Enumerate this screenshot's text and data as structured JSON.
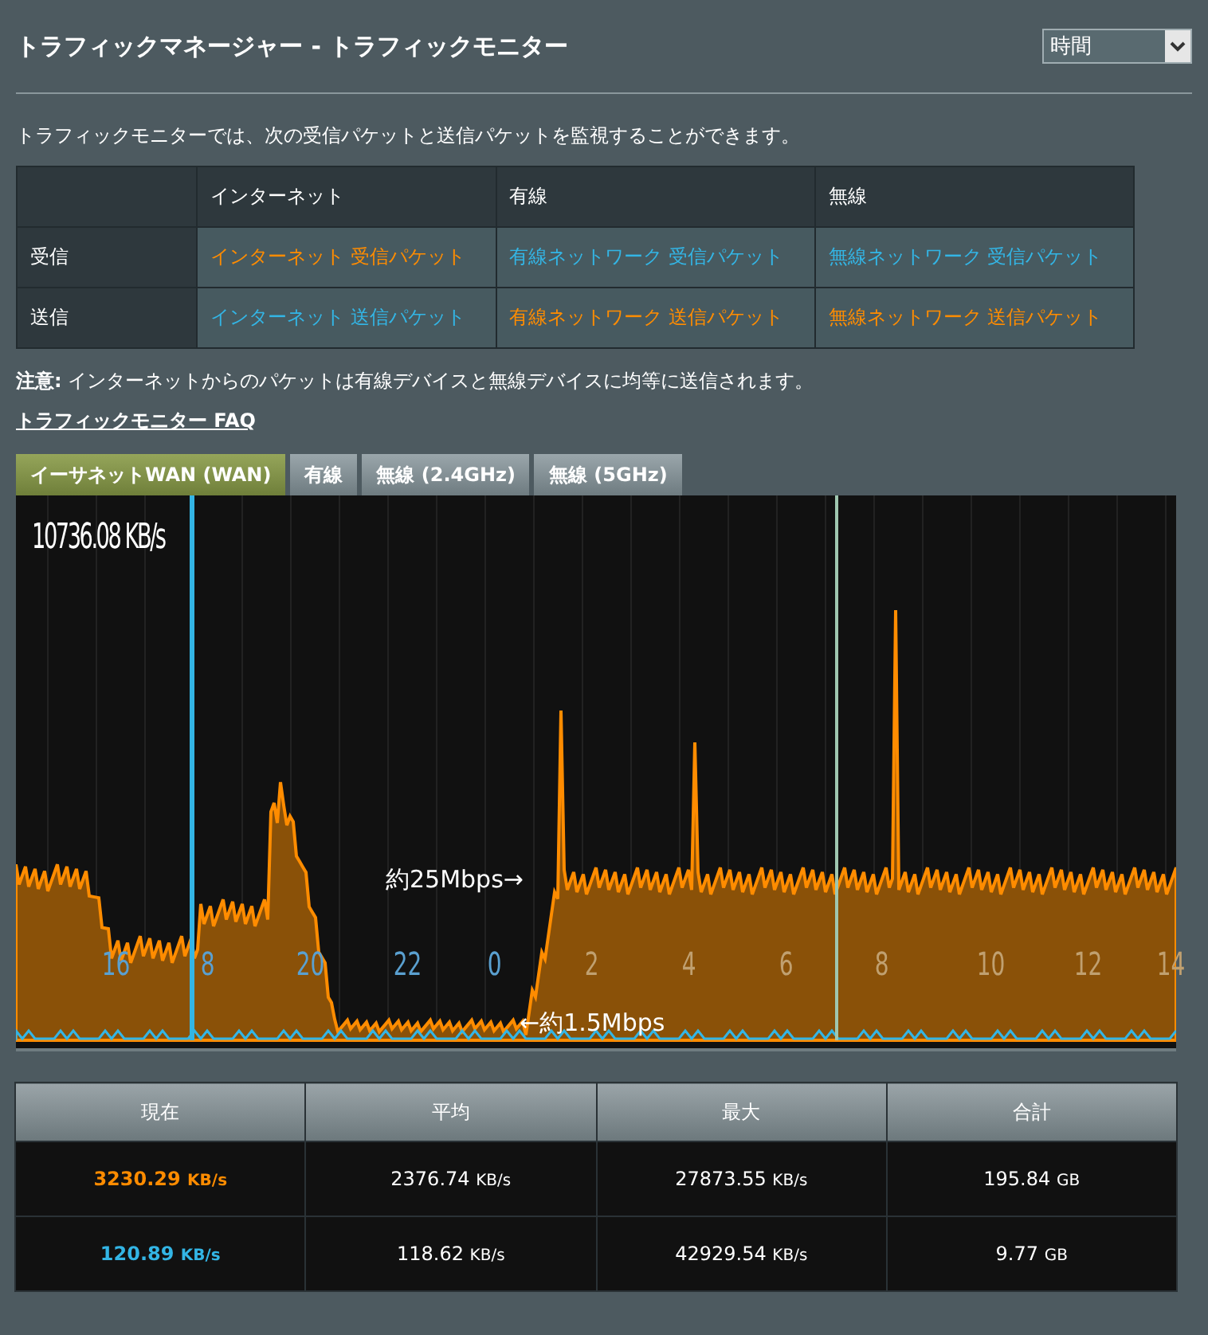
{
  "header": {
    "title": "トラフィックマネージャー - トラフィックモニター",
    "time_select": {
      "value": "時間"
    }
  },
  "description": "トラフィックモニターでは、次の受信パケットと送信パケットを監視することができます。",
  "packet_table": {
    "columns": [
      "インターネット",
      "有線",
      "無線"
    ],
    "rows": [
      {
        "label": "受信",
        "cells": [
          {
            "text": "インターネット 受信パケット",
            "kind": "download"
          },
          {
            "text": "有線ネットワーク 受信パケット",
            "kind": "upload"
          },
          {
            "text": "無線ネットワーク 受信パケット",
            "kind": "upload"
          }
        ]
      },
      {
        "label": "送信",
        "cells": [
          {
            "text": "インターネット 送信パケット",
            "kind": "upload"
          },
          {
            "text": "有線ネットワーク 送信パケット",
            "kind": "download"
          },
          {
            "text": "無線ネットワーク 送信パケット",
            "kind": "download"
          }
        ]
      }
    ]
  },
  "note": "**注意:** インターネットからのパケットは有線デバイスと無線デバイスに均等に送信されます。",
  "faq_link": "トラフィックモニター FAQ",
  "tabs": [
    {
      "label": "イーサネットWAN (WAN)",
      "selected": true
    },
    {
      "label": "有線",
      "selected": false
    },
    {
      "label": "無線 (2.4GHz)",
      "selected": false
    },
    {
      "label": "無線 (5GHz)",
      "selected": false
    }
  ],
  "graph": {
    "peak_reading": "10736.08 KB/s",
    "time_labels": [
      "16",
      "8",
      "20",
      "22",
      "0",
      "2",
      "4",
      "6",
      "8",
      "10",
      "12",
      "14"
    ],
    "annotations": [
      "約25Mbps→",
      "←約1.5Mbps"
    ]
  },
  "stats": {
    "columns": [
      "現在",
      "平均",
      "最大",
      "合計"
    ],
    "rows": [
      {
        "kind": "download",
        "cells": [
          {
            "value": "3230.29",
            "unit": "KB/s"
          },
          {
            "value": "2376.74",
            "unit": "KB/s"
          },
          {
            "value": "27873.55",
            "unit": "KB/s"
          },
          {
            "value": "195.84",
            "unit": "GB"
          }
        ]
      },
      {
        "kind": "upload",
        "cells": [
          {
            "value": "120.89",
            "unit": "KB/s"
          },
          {
            "value": "118.62",
            "unit": "KB/s"
          },
          {
            "value": "42929.54",
            "unit": "KB/s"
          },
          {
            "value": "9.77",
            "unit": "GB"
          }
        ]
      }
    ]
  }
}
